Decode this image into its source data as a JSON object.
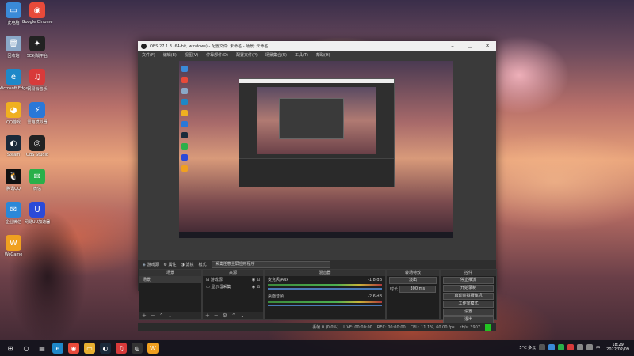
{
  "desktop": {
    "icons": [
      {
        "label": "此电脑",
        "color": "#3a8ad8",
        "glyph": "▭"
      },
      {
        "label": "Google Chrome",
        "color": "#e84a3a",
        "glyph": "◉"
      },
      {
        "label": "回收站",
        "color": "#8aa8c8",
        "glyph": "🗑"
      },
      {
        "label": "5E对战平台",
        "color": "#222222",
        "glyph": "✦"
      },
      {
        "label": "Microsoft Edge",
        "color": "#1e88c8",
        "glyph": "e"
      },
      {
        "label": "网易云音乐",
        "color": "#d83a3a",
        "glyph": "♫"
      },
      {
        "label": "QQ游戏",
        "color": "#f0b020",
        "glyph": "◕"
      },
      {
        "label": "雷电模拟器",
        "color": "#2a78d8",
        "glyph": "⚡"
      },
      {
        "label": "Steam",
        "color": "#1a2a3a",
        "glyph": "◐"
      },
      {
        "label": "OBS Studio",
        "color": "#222222",
        "glyph": "◎"
      },
      {
        "label": "腾讯QQ",
        "color": "#111111",
        "glyph": "🐧"
      },
      {
        "label": "微信",
        "color": "#2ab04a",
        "glyph": "✉"
      },
      {
        "label": "企业微信",
        "color": "#2a88d8",
        "glyph": "✉"
      },
      {
        "label": "网易UU加速器",
        "color": "#2a4ad8",
        "glyph": "U"
      },
      {
        "label": "WeGame",
        "color": "#f0a020",
        "glyph": "W"
      }
    ]
  },
  "obs": {
    "title": "OBS 27.1.3 (64-bit, windows) - 配置文件: 未命名 - 场景: 未命名",
    "menu": [
      "文件(F)",
      "编辑(E)",
      "视图(V)",
      "停靠部件(D)",
      "配置文件(P)",
      "场景集合(S)",
      "工具(T)",
      "帮助(H)"
    ],
    "source_bar": {
      "name": "游戏源",
      "props": "属性",
      "filters": "滤镜",
      "mode_label": "模式",
      "mode_value": "采集任意全屏应用程序"
    },
    "docks": {
      "scenes": {
        "title": "场景",
        "items": [
          "场景"
        ]
      },
      "sources": {
        "title": "来源",
        "items": [
          "游戏源",
          "显示器采集"
        ]
      },
      "mixer": {
        "title": "混音器",
        "tracks": [
          {
            "name": "麦克风/Aux",
            "level": "-1.8 dB"
          },
          {
            "name": "桌面音频",
            "level": "-2.6 dB"
          }
        ]
      },
      "transitions": {
        "title": "转场特效",
        "type": "淡出",
        "duration_label": "时长",
        "duration": "300 ms"
      },
      "controls": {
        "title": "控件",
        "buttons": [
          "停止推流",
          "开始录制",
          "启动虚拟摄像机",
          "工作室模式",
          "设置",
          "退出"
        ]
      }
    },
    "status": [
      "丢帧 0 (0.0%)",
      "LIVE: 00:00:00",
      "REC: 00:00:00",
      "CPU: 11.1%, 60.00 fps",
      "kb/s: 3907"
    ]
  },
  "taskbar": {
    "weather": "5°C 多云",
    "lang": "中",
    "time": "18:29",
    "date": "2022/02/09"
  }
}
